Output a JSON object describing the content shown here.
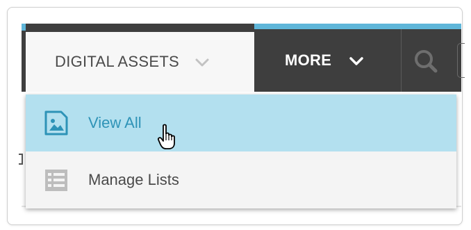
{
  "nav": {
    "tabs": [
      {
        "label": "DIGITAL ASSETS",
        "icon": "chevron-down-icon",
        "state": "open"
      },
      {
        "label": "MORE",
        "icon": "chevron-down-icon"
      }
    ],
    "search_icon": "search-icon"
  },
  "dropdown": {
    "items": [
      {
        "label": "View All",
        "icon": "image-icon",
        "state": "hovered"
      },
      {
        "label": "Manage Lists",
        "icon": "list-icon"
      }
    ]
  },
  "colors": {
    "navbar": "#3e3e3e",
    "accent": "#5fb6d9",
    "hover_bg": "#b3e0ef",
    "hover_text": "#2e93b7"
  }
}
